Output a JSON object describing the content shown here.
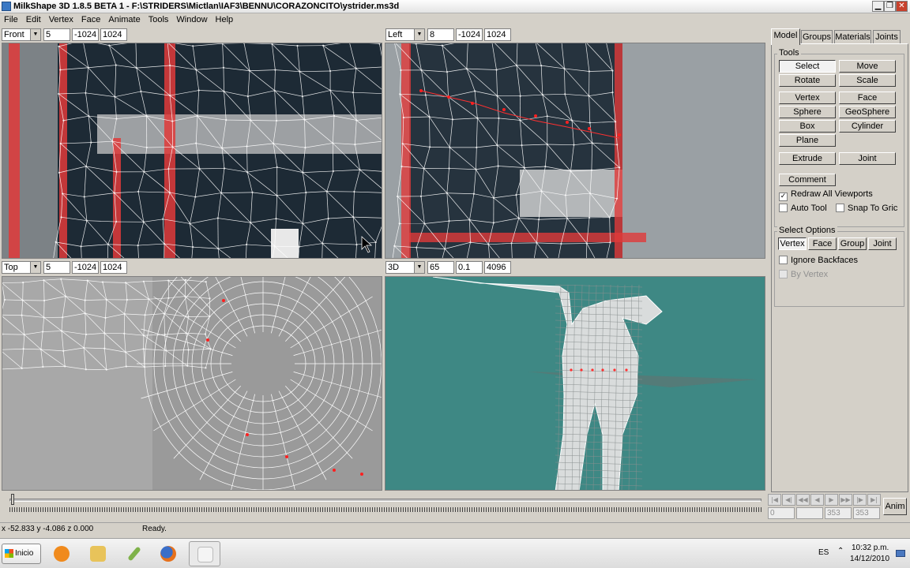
{
  "window": {
    "title": "MilkShape 3D 1.8.5 BETA 1 - F:\\STRIDERS\\Mictlan\\IAF3\\BENNU\\CORAZONCITO\\ystrider.ms3d",
    "minimize": "▁",
    "maximize": "❐",
    "close": "✕"
  },
  "menu": [
    "File",
    "Edit",
    "Vertex",
    "Face",
    "Animate",
    "Tools",
    "Window",
    "Help"
  ],
  "viewports": {
    "front": {
      "view": "Front",
      "v1": "5",
      "v2": "-1024",
      "v3": "1024"
    },
    "left": {
      "view": "Left",
      "v1": "8",
      "v2": "-1024",
      "v3": "1024"
    },
    "top": {
      "view": "Top",
      "v1": "5",
      "v2": "-1024",
      "v3": "1024"
    },
    "persp": {
      "view": "3D",
      "v1": "65",
      "v2": "0.1",
      "v3": "4096"
    }
  },
  "tabs": [
    "Model",
    "Groups",
    "Materials",
    "Joints"
  ],
  "tools": {
    "label": "Tools",
    "buttons": [
      "Select",
      "Move",
      "Rotate",
      "Scale",
      "Vertex",
      "Face",
      "Sphere",
      "GeoSphere",
      "Box",
      "Cylinder",
      "Plane",
      "Extrude",
      "Joint",
      "Comment"
    ]
  },
  "checks": {
    "redraw": {
      "label": "Redraw All Viewports",
      "checked": true
    },
    "autotool": {
      "label": "Auto Tool",
      "checked": false
    },
    "snap": {
      "label": "Snap To Gric",
      "checked": false
    }
  },
  "select_options": {
    "label": "Select Options",
    "buttons": [
      "Vertex",
      "Face",
      "Group",
      "Joint"
    ],
    "ignore_backfaces": "Ignore Backfaces",
    "by_vertex": "By Vertex"
  },
  "animation": {
    "frame_start": "0",
    "frame_current": "",
    "frame_end": "353",
    "frame_total": "353",
    "anim_label": "Anim"
  },
  "status": {
    "coords": "x -52.833 y -4.086 z 0.000",
    "message": "Ready."
  },
  "taskbar": {
    "start_label": "Inicio",
    "lang": "ES",
    "time": "10:32 p.m.",
    "date": "14/12/2010"
  },
  "colors": {
    "viewport_3d_bg": "#3e8884",
    "wire": "#ffffff",
    "selected_vertex": "#ff2020"
  }
}
